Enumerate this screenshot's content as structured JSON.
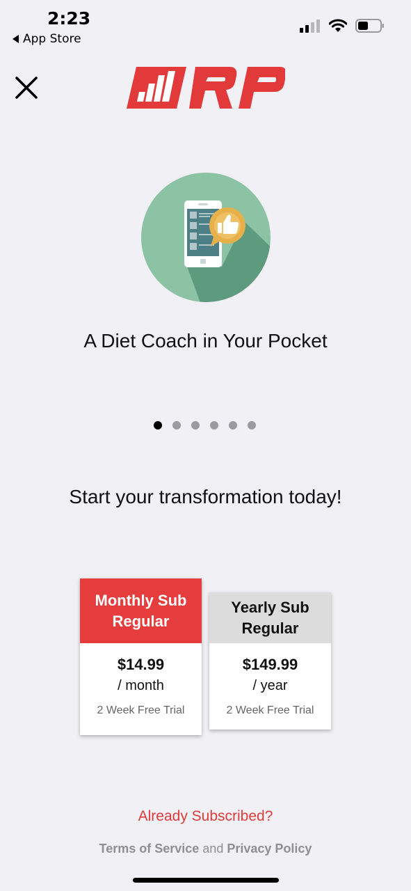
{
  "status_bar": {
    "time": "2:23",
    "back_label": "App Store"
  },
  "header": {
    "logo_text": "RP",
    "close_icon": "close-icon"
  },
  "carousel": {
    "headline": "A Diet Coach in Your Pocket",
    "page_count": 6,
    "active_page": 1
  },
  "cta_title": "Start your transformation today!",
  "plans": [
    {
      "name_line1": "Monthly Sub",
      "name_line2": "Regular",
      "price": "$14.99",
      "period": "/ month",
      "trial": "2 Week Free Trial",
      "selected": true
    },
    {
      "name_line1": "Yearly Sub",
      "name_line2": "Regular",
      "price": "$149.99",
      "period": "/ year",
      "trial": "2 Week Free Trial",
      "selected": false
    }
  ],
  "footer": {
    "already_subscribed": "Already Subscribed?",
    "terms": "Terms of Service",
    "and": "and",
    "privacy": "Privacy Policy"
  },
  "colors": {
    "accent": "#e53d3d",
    "background": "#f1f0f5",
    "hero_circle": "#8dc3a5",
    "hero_shadow": "#5e9a7e"
  }
}
